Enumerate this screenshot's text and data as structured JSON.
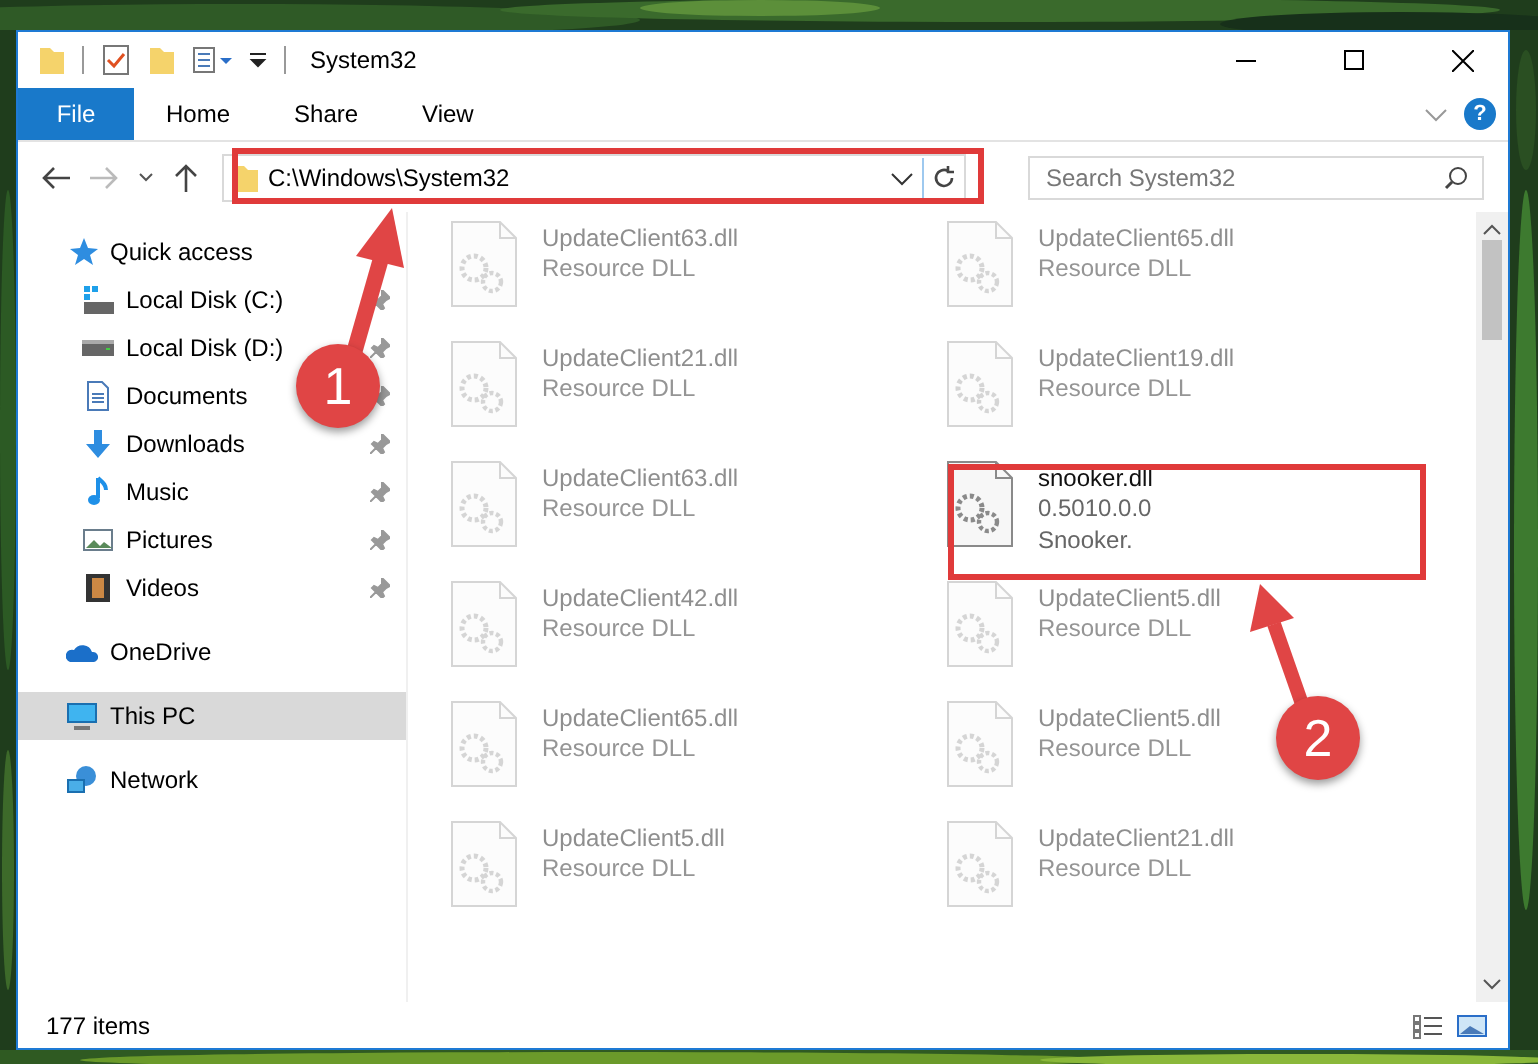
{
  "window": {
    "title": "System32",
    "help": "?"
  },
  "ribbon_tabs": [
    {
      "label": "File",
      "kind": "file",
      "selected": false
    },
    {
      "label": "Home",
      "kind": "tab",
      "selected": false
    },
    {
      "label": "Share",
      "kind": "tab",
      "selected": false
    },
    {
      "label": "View",
      "kind": "tab",
      "selected": false
    }
  ],
  "address": {
    "path": "C:\\Windows\\System32"
  },
  "search": {
    "placeholder": "Search System32"
  },
  "sidebar": {
    "items": [
      {
        "label": "Quick access",
        "kind": "star",
        "pinned": false,
        "selected": false,
        "children": [
          {
            "label": "Local Disk (C:)",
            "kind": "windisk",
            "pinned": true,
            "selected": false
          },
          {
            "label": "Local Disk (D:)",
            "kind": "disk",
            "pinned": true,
            "selected": false
          },
          {
            "label": "Documents",
            "kind": "document",
            "pinned": true,
            "selected": false
          },
          {
            "label": "Downloads",
            "kind": "download",
            "pinned": true,
            "selected": false
          },
          {
            "label": "Music",
            "kind": "music",
            "pinned": true,
            "selected": false
          },
          {
            "label": "Pictures",
            "kind": "pictures",
            "pinned": true,
            "selected": false
          },
          {
            "label": "Videos",
            "kind": "video",
            "pinned": true,
            "selected": false
          }
        ]
      },
      {
        "label": "OneDrive",
        "kind": "cloud",
        "pinned": false,
        "selected": false
      },
      {
        "label": "This PC",
        "kind": "pc",
        "pinned": false,
        "selected": true
      },
      {
        "label": "Network",
        "kind": "network",
        "pinned": false,
        "selected": false
      }
    ]
  },
  "files": [
    {
      "name": "UpdateClient63.dll",
      "details": [
        "Resource DLL"
      ],
      "dimmed": true
    },
    {
      "name": "UpdateClient65.dll",
      "details": [
        "Resource DLL"
      ],
      "dimmed": true
    },
    {
      "name": "UpdateClient21.dll",
      "details": [
        "Resource DLL"
      ],
      "dimmed": true
    },
    {
      "name": "UpdateClient19.dll",
      "details": [
        "Resource DLL"
      ],
      "dimmed": true
    },
    {
      "name": "UpdateClient63.dll",
      "details": [
        "Resource DLL"
      ],
      "dimmed": true
    },
    {
      "name": "snooker.dll",
      "details": [
        "0.5010.0.0",
        "Snooker."
      ],
      "dimmed": false
    },
    {
      "name": "UpdateClient42.dll",
      "details": [
        "Resource DLL"
      ],
      "dimmed": true
    },
    {
      "name": "UpdateClient5.dll",
      "details": [
        "Resource DLL"
      ],
      "dimmed": true
    },
    {
      "name": "UpdateClient65.dll",
      "details": [
        "Resource DLL"
      ],
      "dimmed": true
    },
    {
      "name": "UpdateClient5.dll",
      "details": [
        "Resource DLL"
      ],
      "dimmed": true
    },
    {
      "name": "UpdateClient5.dll",
      "details": [
        "Resource DLL"
      ],
      "dimmed": true
    },
    {
      "name": "UpdateClient21.dll",
      "details": [
        "Resource DLL"
      ],
      "dimmed": true
    }
  ],
  "status_bar": {
    "count": "177 items"
  },
  "annotations": [
    {
      "label": "1"
    },
    {
      "label": "2"
    }
  ]
}
